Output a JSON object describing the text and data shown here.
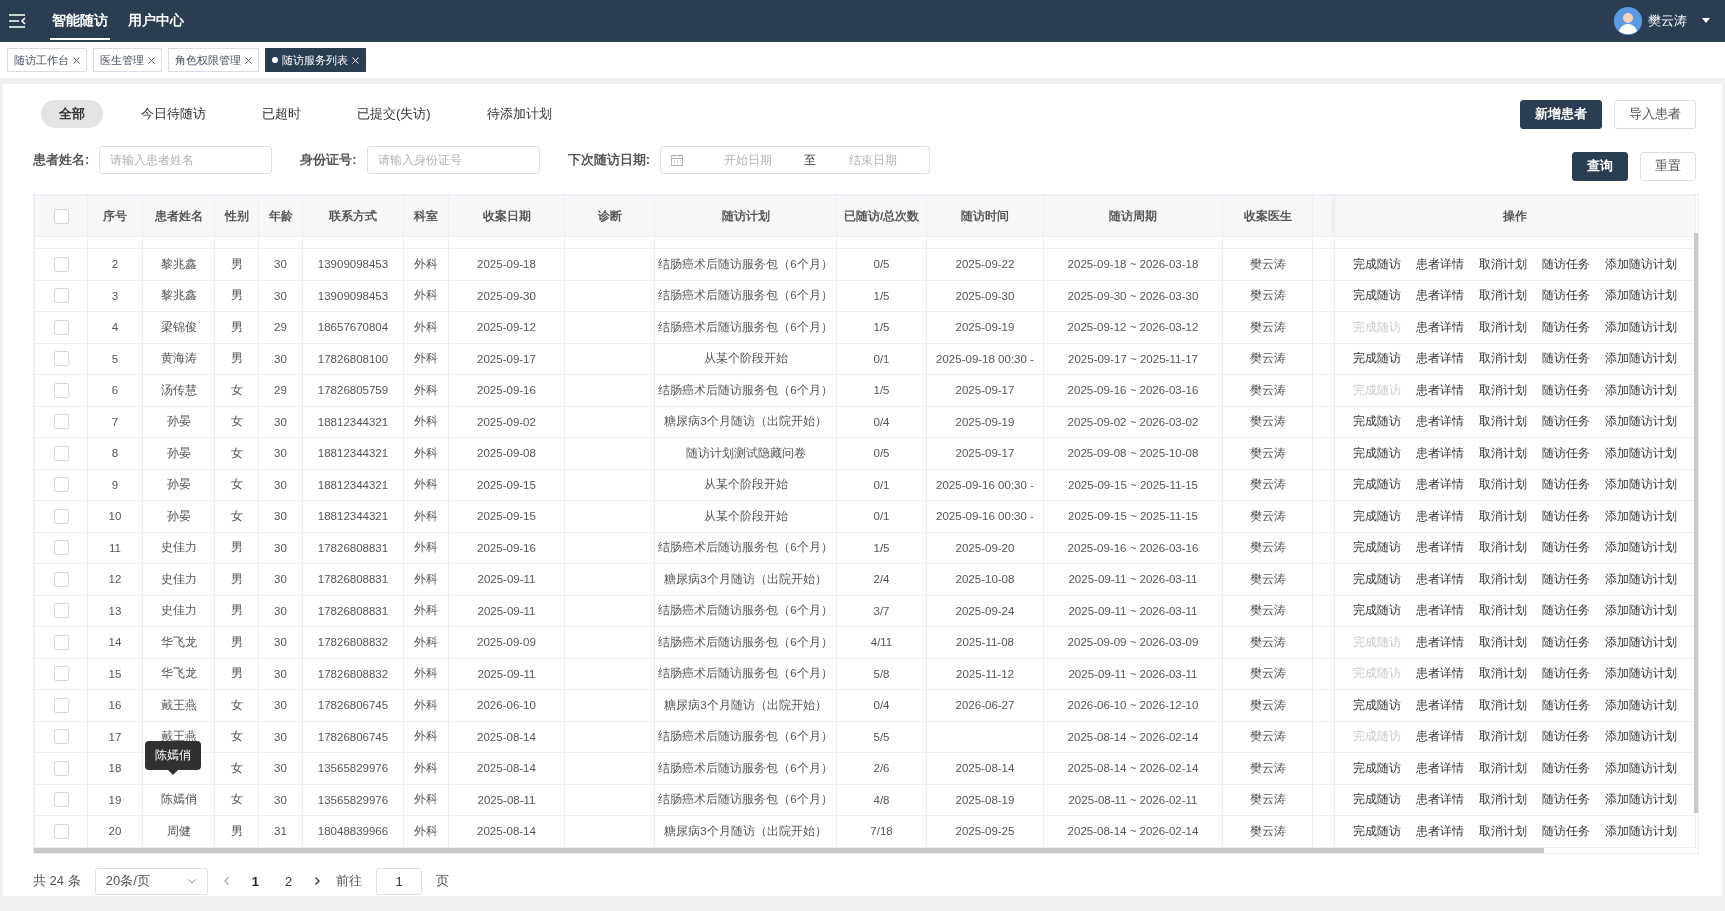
{
  "header": {
    "nav": [
      {
        "label": "智能随访",
        "selected": true
      },
      {
        "label": "用户中心",
        "selected": false
      }
    ],
    "user": {
      "name": "樊云涛"
    }
  },
  "tabs": [
    {
      "label": "随访工作台",
      "selected": false
    },
    {
      "label": "医生管理",
      "selected": false
    },
    {
      "label": "角色权限管理",
      "selected": false
    },
    {
      "label": "随访服务列表",
      "selected": true
    }
  ],
  "filters": [
    {
      "label": "全部",
      "selected": true
    },
    {
      "label": "今日待随访",
      "selected": false
    },
    {
      "label": "已超时",
      "selected": false
    },
    {
      "label": "已提交(失访)",
      "selected": false
    },
    {
      "label": "待添加计划",
      "selected": false
    }
  ],
  "top_buttons": [
    {
      "label": "新增患者",
      "kind": "primary"
    },
    {
      "label": "导入患者",
      "kind": "default"
    }
  ],
  "search_fields": [
    {
      "label": "患者姓名:",
      "placeholder": "请输入患者姓名"
    },
    {
      "label": "身份证号:",
      "placeholder": "请输入身份证号"
    }
  ],
  "date_range": {
    "label": "下次随访日期:",
    "start_placeholder": "开始日期",
    "separator": "至",
    "end_placeholder": "结束日期"
  },
  "search_buttons": [
    {
      "label": "查询",
      "kind": "primary"
    },
    {
      "label": "重置",
      "kind": "default"
    }
  ],
  "table": {
    "header_checked": false,
    "columns": [
      "序号",
      "患者姓名",
      "性别",
      "年龄",
      "联系方式",
      "科室",
      "收案日期",
      "诊断",
      "随访计划",
      "已随访/总次数",
      "随访时间",
      "随访周期",
      "收案医生",
      "操作"
    ],
    "rows": [
      {
        "checked": false,
        "no": "2",
        "name": "黎兆鑫",
        "gender": "男",
        "age": "30",
        "phone": "13909098453",
        "dept": "外科",
        "date": "2025-09-18",
        "plan": "结肠癌术后随访服务包（6个月）",
        "visits": "0/5",
        "visit_time": "2025-09-22",
        "period": "2025-09-18 ~ 2026-03-18",
        "doctor": "樊云涛",
        "actions": [
          {
            "label": "完成随访",
            "disabled": false
          },
          {
            "label": "患者详情",
            "disabled": false
          },
          {
            "label": "取消计划",
            "disabled": false
          },
          {
            "label": "随访任务",
            "disabled": false
          },
          {
            "label": "添加随访计划",
            "disabled": false
          }
        ]
      },
      {
        "checked": false,
        "no": "3",
        "name": "黎兆鑫",
        "gender": "男",
        "age": "30",
        "phone": "13909098453",
        "dept": "外科",
        "date": "2025-09-30",
        "plan": "结肠癌术后随访服务包（6个月）",
        "visits": "1/5",
        "visit_time": "2025-09-30",
        "period": "2025-09-30 ~ 2026-03-30",
        "doctor": "樊云涛",
        "actions": [
          {
            "label": "完成随访",
            "disabled": false
          },
          {
            "label": "患者详情",
            "disabled": false
          },
          {
            "label": "取消计划",
            "disabled": false
          },
          {
            "label": "随访任务",
            "disabled": false
          },
          {
            "label": "添加随访计划",
            "disabled": false
          }
        ]
      },
      {
        "checked": false,
        "no": "4",
        "name": "梁锦俊",
        "gender": "男",
        "age": "29",
        "phone": "18657670804",
        "dept": "外科",
        "date": "2025-09-12",
        "plan": "结肠癌术后随访服务包（6个月）",
        "visits": "1/5",
        "visit_time": "2025-09-19",
        "period": "2025-09-12 ~ 2026-03-12",
        "doctor": "樊云涛",
        "actions": [
          {
            "label": "完成随访",
            "disabled": true
          },
          {
            "label": "患者详情",
            "disabled": false
          },
          {
            "label": "取消计划",
            "disabled": false
          },
          {
            "label": "随访任务",
            "disabled": false
          },
          {
            "label": "添加随访计划",
            "disabled": false
          }
        ]
      },
      {
        "checked": false,
        "no": "5",
        "name": "黄海涛",
        "gender": "男",
        "age": "30",
        "phone": "17826808100",
        "dept": "外科",
        "date": "2025-09-17",
        "plan": "从某个阶段开始",
        "visits": "0/1",
        "visit_time": "2025-09-18 00:30 -",
        "period": "2025-09-17 ~ 2025-11-17",
        "doctor": "樊云涛",
        "actions": [
          {
            "label": "完成随访",
            "disabled": false
          },
          {
            "label": "患者详情",
            "disabled": false
          },
          {
            "label": "取消计划",
            "disabled": false
          },
          {
            "label": "随访任务",
            "disabled": false
          },
          {
            "label": "添加随访计划",
            "disabled": false
          }
        ]
      },
      {
        "checked": false,
        "no": "6",
        "name": "汤传慧",
        "gender": "女",
        "age": "29",
        "phone": "17826805759",
        "dept": "外科",
        "date": "2025-09-16",
        "plan": "结肠癌术后随访服务包（6个月）",
        "visits": "1/5",
        "visit_time": "2025-09-17",
        "period": "2025-09-16 ~ 2026-03-16",
        "doctor": "樊云涛",
        "actions": [
          {
            "label": "完成随访",
            "disabled": true
          },
          {
            "label": "患者详情",
            "disabled": false
          },
          {
            "label": "取消计划",
            "disabled": false
          },
          {
            "label": "随访任务",
            "disabled": false
          },
          {
            "label": "添加随访计划",
            "disabled": false
          }
        ]
      },
      {
        "checked": false,
        "no": "7",
        "name": "孙晏",
        "gender": "女",
        "age": "30",
        "phone": "18812344321",
        "dept": "外科",
        "date": "2025-09-02",
        "plan": "糖尿病3个月随访（出院开始）",
        "visits": "0/4",
        "visit_time": "2025-09-19",
        "period": "2025-09-02 ~ 2026-03-02",
        "doctor": "樊云涛",
        "actions": [
          {
            "label": "完成随访",
            "disabled": false
          },
          {
            "label": "患者详情",
            "disabled": false
          },
          {
            "label": "取消计划",
            "disabled": false
          },
          {
            "label": "随访任务",
            "disabled": false
          },
          {
            "label": "添加随访计划",
            "disabled": false
          }
        ]
      },
      {
        "checked": false,
        "no": "8",
        "name": "孙晏",
        "gender": "女",
        "age": "30",
        "phone": "18812344321",
        "dept": "外科",
        "date": "2025-09-08",
        "plan": "随访计划测试隐藏问卷",
        "visits": "0/5",
        "visit_time": "2025-09-17",
        "period": "2025-09-08 ~ 2025-10-08",
        "doctor": "樊云涛",
        "actions": [
          {
            "label": "完成随访",
            "disabled": false
          },
          {
            "label": "患者详情",
            "disabled": false
          },
          {
            "label": "取消计划",
            "disabled": false
          },
          {
            "label": "随访任务",
            "disabled": false
          },
          {
            "label": "添加随访计划",
            "disabled": false
          }
        ]
      },
      {
        "checked": false,
        "no": "9",
        "name": "孙晏",
        "gender": "女",
        "age": "30",
        "phone": "18812344321",
        "dept": "外科",
        "date": "2025-09-15",
        "plan": "从某个阶段开始",
        "visits": "0/1",
        "visit_time": "2025-09-16 00:30 -",
        "period": "2025-09-15 ~ 2025-11-15",
        "doctor": "樊云涛",
        "actions": [
          {
            "label": "完成随访",
            "disabled": false
          },
          {
            "label": "患者详情",
            "disabled": false
          },
          {
            "label": "取消计划",
            "disabled": false
          },
          {
            "label": "随访任务",
            "disabled": false
          },
          {
            "label": "添加随访计划",
            "disabled": false
          }
        ]
      },
      {
        "checked": false,
        "no": "10",
        "name": "孙晏",
        "gender": "女",
        "age": "30",
        "phone": "18812344321",
        "dept": "外科",
        "date": "2025-09-15",
        "plan": "从某个阶段开始",
        "visits": "0/1",
        "visit_time": "2025-09-16 00:30 -",
        "period": "2025-09-15 ~ 2025-11-15",
        "doctor": "樊云涛",
        "actions": [
          {
            "label": "完成随访",
            "disabled": false
          },
          {
            "label": "患者详情",
            "disabled": false
          },
          {
            "label": "取消计划",
            "disabled": false
          },
          {
            "label": "随访任务",
            "disabled": false
          },
          {
            "label": "添加随访计划",
            "disabled": false
          }
        ]
      },
      {
        "checked": false,
        "no": "11",
        "name": "史佳力",
        "gender": "男",
        "age": "30",
        "phone": "17826808831",
        "dept": "外科",
        "date": "2025-09-16",
        "plan": "结肠癌术后随访服务包（6个月）",
        "visits": "1/5",
        "visit_time": "2025-09-20",
        "period": "2025-09-16 ~ 2026-03-16",
        "doctor": "樊云涛",
        "actions": [
          {
            "label": "完成随访",
            "disabled": false
          },
          {
            "label": "患者详情",
            "disabled": false
          },
          {
            "label": "取消计划",
            "disabled": false
          },
          {
            "label": "随访任务",
            "disabled": false
          },
          {
            "label": "添加随访计划",
            "disabled": false
          }
        ]
      },
      {
        "checked": false,
        "no": "12",
        "name": "史佳力",
        "gender": "男",
        "age": "30",
        "phone": "17826808831",
        "dept": "外科",
        "date": "2025-09-11",
        "plan": "糖尿病3个月随访（出院开始）",
        "visits": "2/4",
        "visit_time": "2025-10-08",
        "period": "2025-09-11 ~ 2026-03-11",
        "doctor": "樊云涛",
        "actions": [
          {
            "label": "完成随访",
            "disabled": false
          },
          {
            "label": "患者详情",
            "disabled": false
          },
          {
            "label": "取消计划",
            "disabled": false
          },
          {
            "label": "随访任务",
            "disabled": false
          },
          {
            "label": "添加随访计划",
            "disabled": false
          }
        ]
      },
      {
        "checked": false,
        "no": "13",
        "name": "史佳力",
        "gender": "男",
        "age": "30",
        "phone": "17826808831",
        "dept": "外科",
        "date": "2025-09-11",
        "plan": "结肠癌术后随访服务包（6个月）",
        "visits": "3/7",
        "visit_time": "2025-09-24",
        "period": "2025-09-11 ~ 2026-03-11",
        "doctor": "樊云涛",
        "actions": [
          {
            "label": "完成随访",
            "disabled": false
          },
          {
            "label": "患者详情",
            "disabled": false
          },
          {
            "label": "取消计划",
            "disabled": false
          },
          {
            "label": "随访任务",
            "disabled": false
          },
          {
            "label": "添加随访计划",
            "disabled": false
          }
        ]
      },
      {
        "checked": false,
        "no": "14",
        "name": "华飞龙",
        "gender": "男",
        "age": "30",
        "phone": "17826808832",
        "dept": "外科",
        "date": "2025-09-09",
        "plan": "结肠癌术后随访服务包（6个月）",
        "visits": "4/11",
        "visit_time": "2025-11-08",
        "period": "2025-09-09 ~ 2026-03-09",
        "doctor": "樊云涛",
        "actions": [
          {
            "label": "完成随访",
            "disabled": true
          },
          {
            "label": "患者详情",
            "disabled": false
          },
          {
            "label": "取消计划",
            "disabled": false
          },
          {
            "label": "随访任务",
            "disabled": false
          },
          {
            "label": "添加随访计划",
            "disabled": false
          }
        ]
      },
      {
        "checked": false,
        "no": "15",
        "name": "华飞龙",
        "gender": "男",
        "age": "30",
        "phone": "17826808832",
        "dept": "外科",
        "date": "2025-09-11",
        "plan": "结肠癌术后随访服务包（6个月）",
        "visits": "5/8",
        "visit_time": "2025-11-12",
        "period": "2025-09-11 ~ 2026-03-11",
        "doctor": "樊云涛",
        "actions": [
          {
            "label": "完成随访",
            "disabled": true
          },
          {
            "label": "患者详情",
            "disabled": false
          },
          {
            "label": "取消计划",
            "disabled": false
          },
          {
            "label": "随访任务",
            "disabled": false
          },
          {
            "label": "添加随访计划",
            "disabled": false
          }
        ]
      },
      {
        "checked": false,
        "no": "16",
        "name": "戴王燕",
        "gender": "女",
        "age": "30",
        "phone": "17826806745",
        "dept": "外科",
        "date": "2026-06-10",
        "plan": "糖尿病3个月随访（出院开始）",
        "visits": "0/4",
        "visit_time": "2026-06-27",
        "period": "2026-06-10 ~ 2026-12-10",
        "doctor": "樊云涛",
        "actions": [
          {
            "label": "完成随访",
            "disabled": false
          },
          {
            "label": "患者详情",
            "disabled": false
          },
          {
            "label": "取消计划",
            "disabled": false
          },
          {
            "label": "随访任务",
            "disabled": false
          },
          {
            "label": "添加随访计划",
            "disabled": false
          }
        ]
      },
      {
        "checked": false,
        "no": "17",
        "name": "戴王燕",
        "gender": "女",
        "age": "30",
        "phone": "17826806745",
        "dept": "外科",
        "date": "2025-08-14",
        "plan": "结肠癌术后随访服务包（6个月）",
        "visits": "5/5",
        "period": "2025-08-14 ~ 2026-02-14",
        "doctor": "樊云涛",
        "actions": [
          {
            "label": "完成随访",
            "disabled": true
          },
          {
            "label": "患者详情",
            "disabled": false
          },
          {
            "label": "取消计划",
            "disabled": false
          },
          {
            "label": "随访任务",
            "disabled": false
          },
          {
            "label": "添加随访计划",
            "disabled": false
          }
        ]
      },
      {
        "checked": false,
        "no": "18",
        "tooltip": "陈嫣俏",
        "gender": "女",
        "age": "30",
        "phone": "13565829976",
        "dept": "外科",
        "date": "2025-08-14",
        "plan": "结肠癌术后随访服务包（6个月）",
        "visits": "2/6",
        "visit_time": "2025-08-14",
        "period": "2025-08-14 ~ 2026-02-14",
        "doctor": "樊云涛",
        "actions": [
          {
            "label": "完成随访",
            "disabled": false
          },
          {
            "label": "患者详情",
            "disabled": false
          },
          {
            "label": "取消计划",
            "disabled": false
          },
          {
            "label": "随访任务",
            "disabled": false
          },
          {
            "label": "添加随访计划",
            "disabled": false
          }
        ]
      },
      {
        "checked": false,
        "no": "19",
        "name": "陈嫣俏",
        "gender": "女",
        "age": "30",
        "phone": "13565829976",
        "dept": "外科",
        "date": "2025-08-11",
        "plan": "结肠癌术后随访服务包（6个月）",
        "visits": "4/8",
        "visit_time": "2025-08-19",
        "period": "2025-08-11 ~ 2026-02-11",
        "doctor": "樊云涛",
        "actions": [
          {
            "label": "完成随访",
            "disabled": false
          },
          {
            "label": "患者详情",
            "disabled": false
          },
          {
            "label": "取消计划",
            "disabled": false
          },
          {
            "label": "随访任务",
            "disabled": false
          },
          {
            "label": "添加随访计划",
            "disabled": false
          }
        ]
      },
      {
        "checked": false,
        "no": "20",
        "name": "周健",
        "gender": "男",
        "age": "31",
        "phone": "18048839966",
        "dept": "外科",
        "date": "2025-08-14",
        "plan": "糖尿病3个月随访（出院开始）",
        "visits": "7/18",
        "visit_time": "2025-09-25",
        "period": "2025-08-14 ~ 2026-02-14",
        "doctor": "樊云涛",
        "actions": [
          {
            "label": "完成随访",
            "disabled": false
          },
          {
            "label": "患者详情",
            "disabled": false
          },
          {
            "label": "取消计划",
            "disabled": false
          },
          {
            "label": "随访任务",
            "disabled": false
          },
          {
            "label": "添加随访计划",
            "disabled": false
          }
        ]
      }
    ]
  },
  "pagination": {
    "total": "共 24 条",
    "page_size": "20条/页",
    "pages": [
      {
        "label": "1",
        "selected": true
      },
      {
        "label": "2",
        "selected": false
      }
    ],
    "goto_label": "前往",
    "goto_value": "1",
    "goto_suffix": "页"
  }
}
